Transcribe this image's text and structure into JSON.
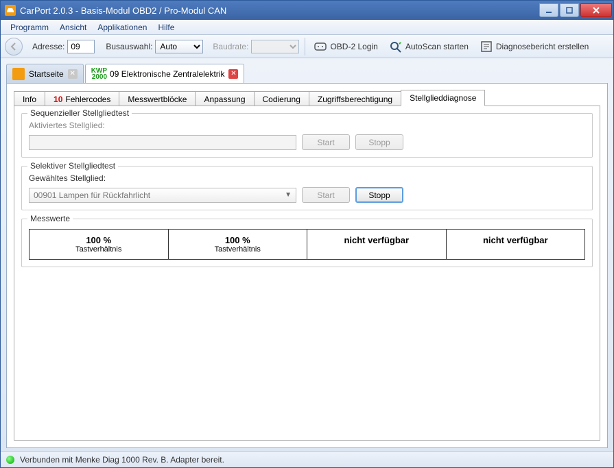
{
  "titlebar": {
    "title": "CarPort 2.0.3  - Basis-Modul OBD2 / Pro-Modul CAN"
  },
  "menu": {
    "programm": "Programm",
    "ansicht": "Ansicht",
    "applikationen": "Applikationen",
    "hilfe": "Hilfe"
  },
  "toolbar": {
    "adresse_label": "Adresse:",
    "adresse_value": "09",
    "busauswahl_label": "Busauswahl:",
    "busauswahl_value": "Auto",
    "baudrate_label": "Baudrate:",
    "baudrate_value": "",
    "obd2_login": "OBD-2 Login",
    "autoscan": "AutoScan starten",
    "diag_report": "Diagnosebericht erstellen"
  },
  "top_tabs": {
    "startseite": "Startseite",
    "kwp_line1": "KWP",
    "kwp_line2": "2000",
    "module_label": "09 Elektronische Zentralelektrik"
  },
  "sub_tabs": {
    "info": "Info",
    "fehlercodes_count": "10",
    "fehlercodes": "Fehlercodes",
    "messwertbloecke": "Messwertblöcke",
    "anpassung": "Anpassung",
    "codierung": "Codierung",
    "zugriff": "Zugriffsberechtigung",
    "stellglied": "Stellglieddiagnose"
  },
  "seq": {
    "legend": "Sequenzieller Stellgliedtest",
    "label": "Aktiviertes Stellglied:",
    "start": "Start",
    "stopp": "Stopp"
  },
  "sel": {
    "legend": "Selektiver Stellgliedtest",
    "label": "Gewähltes Stellglied:",
    "combo_value": "00901 Lampen für Rückfahrlicht",
    "start": "Start",
    "stopp": "Stopp"
  },
  "mw": {
    "legend": "Messwerte",
    "cells": [
      {
        "val": "100 %",
        "lbl": "Tastverhältnis"
      },
      {
        "val": "100 %",
        "lbl": "Tastverhältnis"
      },
      {
        "val": "nicht verfügbar",
        "lbl": ""
      },
      {
        "val": "nicht verfügbar",
        "lbl": ""
      }
    ]
  },
  "status": {
    "text": "Verbunden mit Menke Diag 1000 Rev. B. Adapter bereit."
  }
}
